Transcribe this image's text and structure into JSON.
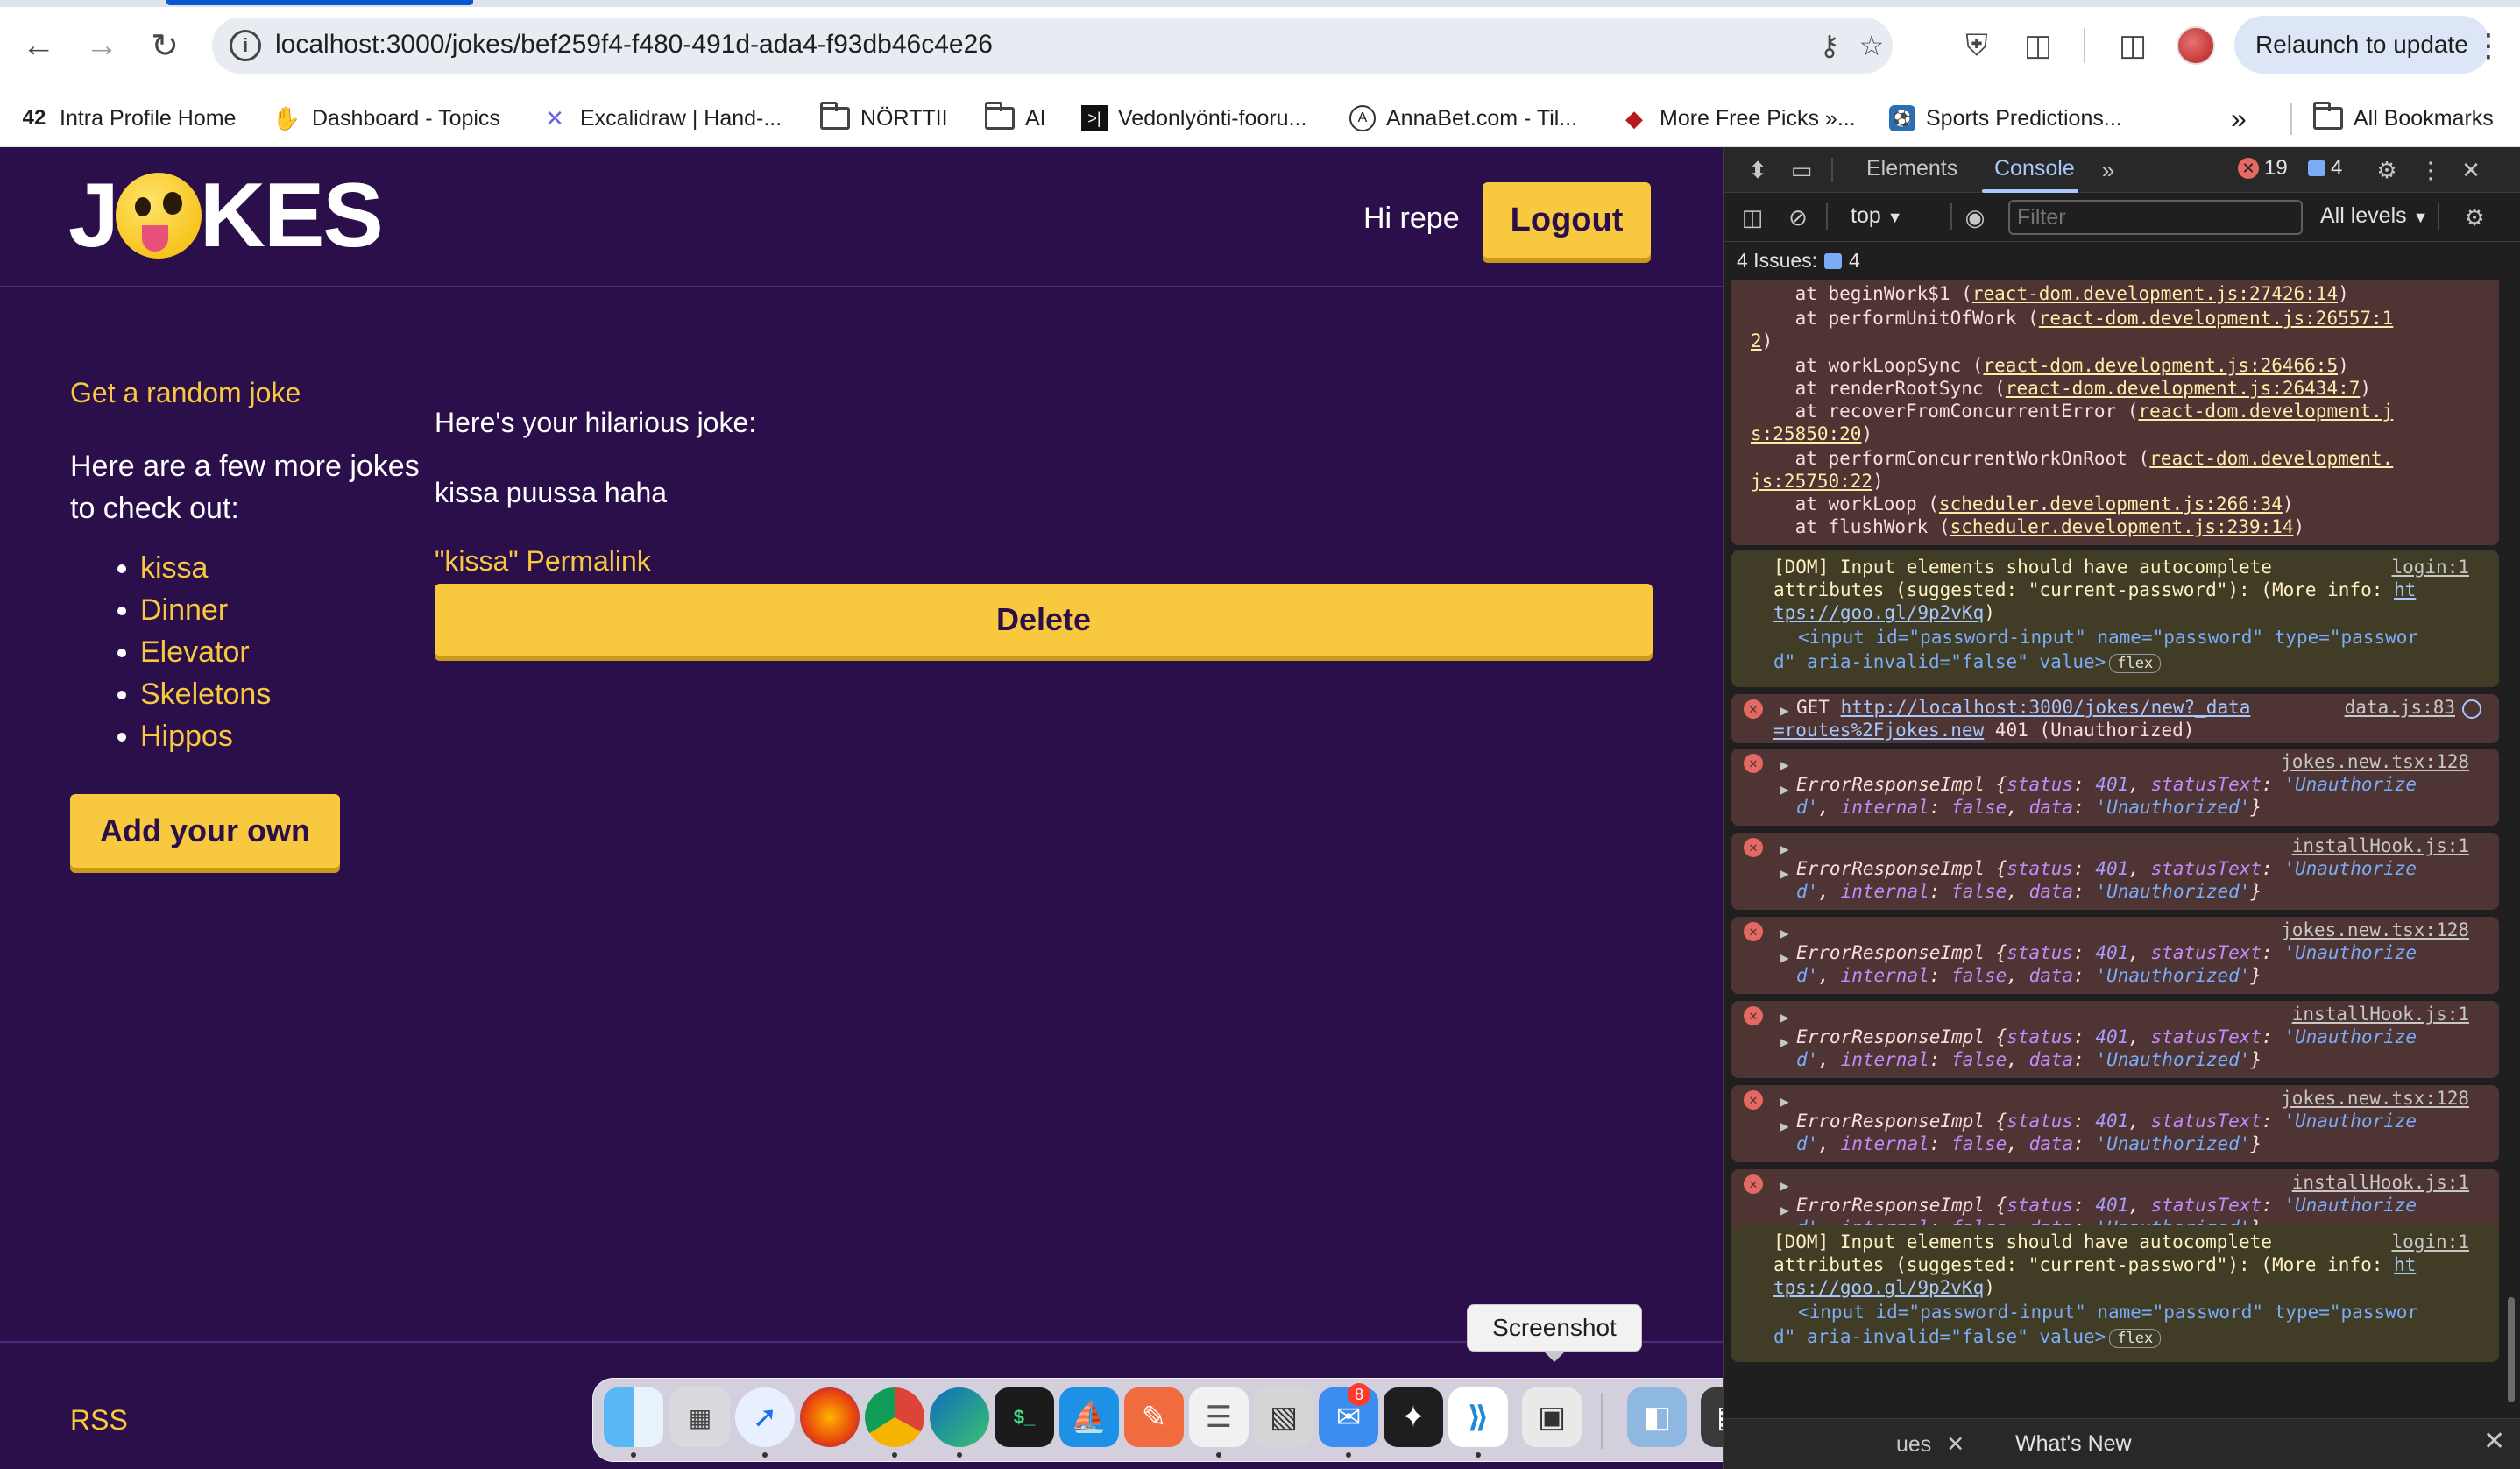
{
  "browser": {
    "url": "localhost:3000/jokes/bef259f4-f480-491d-ada4-f93db46c4e26",
    "relaunch_label": "Relaunch to update",
    "bookmarks": [
      {
        "label": "Intra Profile Home",
        "icon": "intra-icon"
      },
      {
        "label": "Dashboard - Topics",
        "icon": "hand-icon"
      },
      {
        "label": "Excalidraw | Hand-...",
        "icon": "excalidraw-icon"
      },
      {
        "label": "NÖRTTII",
        "icon": "folder-icon"
      },
      {
        "label": "AI",
        "icon": "folder-icon"
      },
      {
        "label": "Vedonlyönti-fooru...",
        "icon": "terminal-icon"
      },
      {
        "label": "AnnaBet.com - Til...",
        "icon": "annabet-icon"
      },
      {
        "label": "More Free Picks »...",
        "icon": "picks-icon"
      },
      {
        "label": "Sports Predictions...",
        "icon": "sports-icon"
      }
    ],
    "more_bookmarks_glyph": "»",
    "all_bookmarks_label": "All Bookmarks"
  },
  "site": {
    "logo_left": "J",
    "logo_right": "KES",
    "greeting": "Hi repe",
    "logout_label": "Logout",
    "random_joke_link": "Get a random joke",
    "more_jokes_text": "Here are a few more jokes to check out:",
    "jokes": [
      "kissa",
      "Dinner",
      "Elevator",
      "Skeletons",
      "Hippos"
    ],
    "add_own_label": "Add your own",
    "joke_intro": "Here's your hilarious joke:",
    "joke_content": "kissa puussa haha",
    "permalink": "\"kissa\" Permalink",
    "delete_label": "Delete",
    "rss_label": "RSS"
  },
  "dock": {
    "tooltip": "Screenshot",
    "mail_badge": "8"
  },
  "devtools": {
    "tabs": {
      "elements": "Elements",
      "console": "Console"
    },
    "error_count": "19",
    "message_count": "4",
    "context": "top",
    "filter_placeholder": "Filter",
    "levels": "All levels",
    "issues_label": "4 Issues:",
    "issues_count": "4",
    "drawer_issues": "ues",
    "drawer_whatsnew": "What's New",
    "stack": [
      {
        "pre": "    at beginWork$1 (",
        "link": "react-dom.development.js:27426:14",
        "post": ")"
      },
      {
        "pre": "    at performUnitOfWork (",
        "link": "react-dom.development.js:26557:1",
        "post": ""
      },
      {
        "pre": "",
        "link": "2",
        "post": ")"
      },
      {
        "pre": "    at workLoopSync (",
        "link": "react-dom.development.js:26466:5",
        "post": ")"
      },
      {
        "pre": "    at renderRootSync (",
        "link": "react-dom.development.js:26434:7",
        "post": ")"
      },
      {
        "pre": "    at recoverFromConcurrentError (",
        "link": "react-dom.development.j",
        "post": ""
      },
      {
        "pre": "",
        "link": "s:25850:20",
        "post": ")"
      },
      {
        "pre": "    at performConcurrentWorkOnRoot (",
        "link": "react-dom.development.",
        "post": ""
      },
      {
        "pre": "",
        "link": "js:25750:22",
        "post": ")"
      },
      {
        "pre": "    at workLoop (",
        "link": "scheduler.development.js:266:34",
        "post": ")"
      },
      {
        "pre": "    at flushWork (",
        "link": "scheduler.development.js:239:14",
        "post": ")"
      }
    ],
    "dom_warning": {
      "l1": "[DOM] Input elements should have autocomplete",
      "l2": "attributes (suggested: \"current-password\"): (More info: ",
      "link1": "ht",
      "link2": "tps://goo.gl/9p2vKq",
      "l3_close": ")",
      "source": "login:1",
      "code1": "<input id=\"password-input\" name=\"password\" type=\"passwor",
      "code2": "d\" aria-invalid=\"false\" value>",
      "badge": "flex"
    },
    "get_error": {
      "method": "GET ",
      "url": "http://localhost:3000/jokes/new?_data",
      "source": "data.js:83",
      "url2": "=routes%2Fjokes.new",
      "status": " 401 (Unauthorized)"
    },
    "error_entries": [
      {
        "source": "jokes.new.tsx:128"
      },
      {
        "source": "installHook.js:1"
      },
      {
        "source": "jokes.new.tsx:128"
      },
      {
        "source": "installHook.js:1"
      },
      {
        "source": "jokes.new.tsx:128"
      },
      {
        "source": "installHook.js:1"
      }
    ],
    "error_text": {
      "name": "ErrorResponseImpl {",
      "status_key": "status",
      "status_val": "401",
      "statusText_key": "statusText",
      "statusText_val1": "'Unauthorize",
      "statusText_val2": "d'",
      "internal_key": "internal",
      "internal_val": "false",
      "data_key": "data",
      "data_val": "'Unauthorized'"
    }
  }
}
